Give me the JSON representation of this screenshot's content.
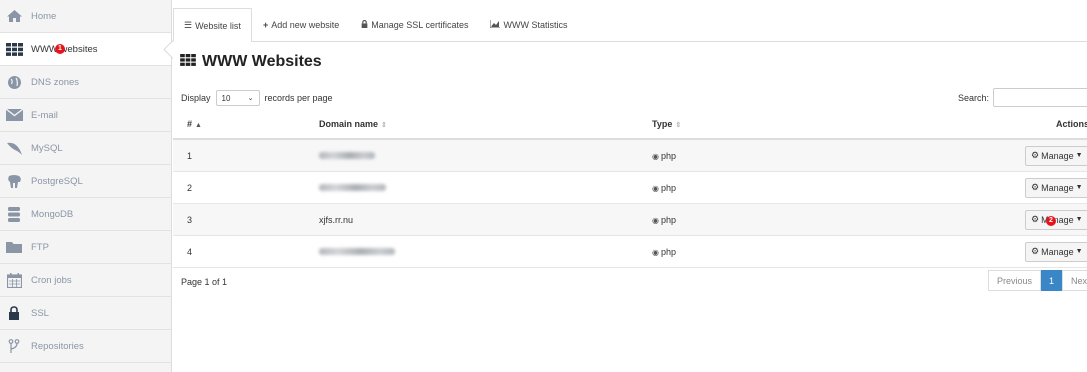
{
  "sidebar": {
    "items": [
      {
        "label": "Home",
        "icon": "home-icon"
      },
      {
        "label": "WWW websites",
        "icon": "grid-icon",
        "active": true,
        "marker": "1"
      },
      {
        "label": "DNS zones",
        "icon": "globe-icon"
      },
      {
        "label": "E-mail",
        "icon": "envelope-icon"
      },
      {
        "label": "MySQL",
        "icon": "dolphin-icon"
      },
      {
        "label": "PostgreSQL",
        "icon": "elephant-icon"
      },
      {
        "label": "MongoDB",
        "icon": "database-icon"
      },
      {
        "label": "FTP",
        "icon": "folder-icon"
      },
      {
        "label": "Cron jobs",
        "icon": "calendar-icon"
      },
      {
        "label": "SSL",
        "icon": "lock-icon"
      },
      {
        "label": "Repositories",
        "icon": "branch-icon"
      }
    ]
  },
  "tabs": [
    {
      "label": "Website list",
      "icon": "list-icon",
      "active": true
    },
    {
      "label": "Add new website",
      "icon": "plus-icon"
    },
    {
      "label": "Manage SSL certificates",
      "icon": "lock-icon"
    },
    {
      "label": "WWW Statistics",
      "icon": "chart-icon"
    }
  ],
  "page": {
    "title": "WWW Websites"
  },
  "length": {
    "prefix": "Display",
    "value": "10",
    "suffix": "records per page"
  },
  "search": {
    "label": "Search:",
    "value": ""
  },
  "table": {
    "columns": [
      "#",
      "Domain name",
      "Type",
      "Actions"
    ],
    "rows": [
      {
        "num": "1",
        "domain": "",
        "type": "php",
        "action": "Manage"
      },
      {
        "num": "2",
        "domain": "",
        "type": "php",
        "action": "Manage"
      },
      {
        "num": "3",
        "domain": "xjfs.rr.nu",
        "type": "php",
        "action": "Manage",
        "marker": "2"
      },
      {
        "num": "4",
        "domain": "",
        "type": "php",
        "action": "Manage"
      }
    ]
  },
  "footer": {
    "page_info": "Page 1 of 1",
    "previous": "Previous",
    "current_page": "1",
    "next": "Next"
  },
  "colors": {
    "accent": "#3a87c8",
    "marker": "#e8141b",
    "sidebar_bg": "#f4f4f4"
  }
}
